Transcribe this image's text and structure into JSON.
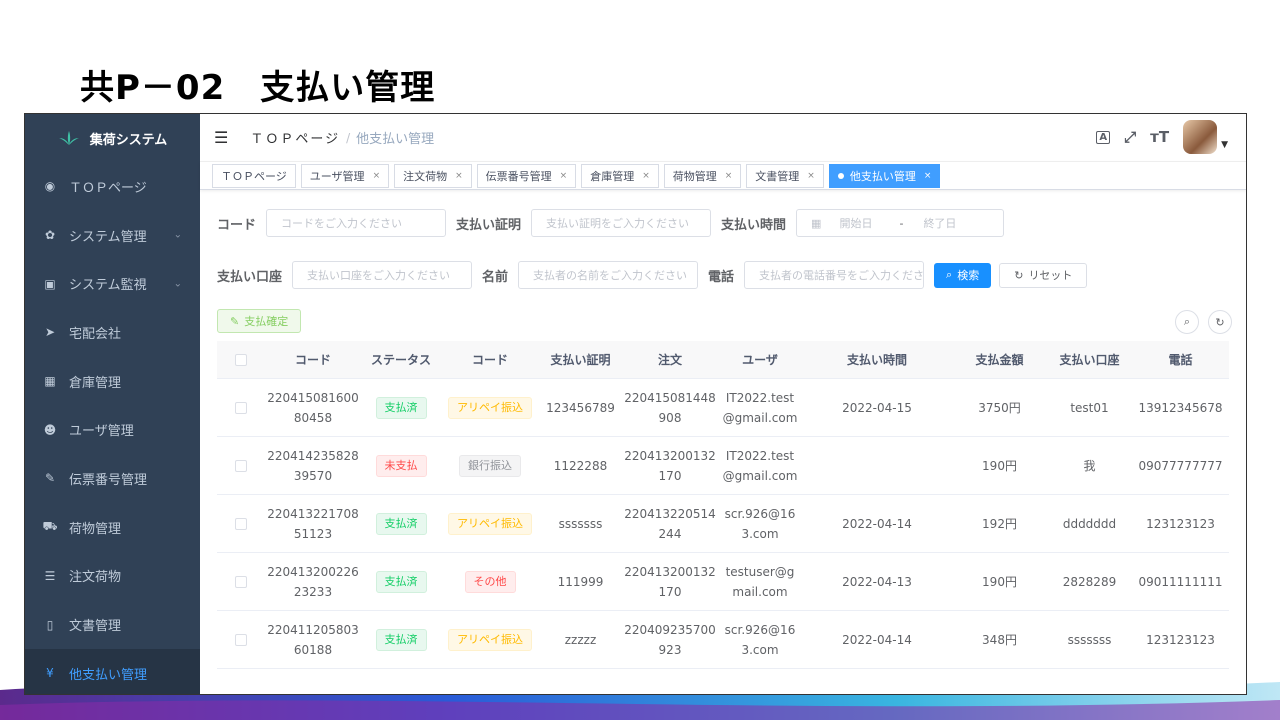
{
  "slide": {
    "title": "共P－02　支払い管理"
  },
  "sidebar": {
    "brand": "集荷システム",
    "items": [
      {
        "label": "ＴＯＰページ",
        "icon": "dashboard-icon",
        "glyph": "◉",
        "chevron": false
      },
      {
        "label": "システム管理",
        "icon": "gear-icon",
        "glyph": "✿",
        "chevron": true
      },
      {
        "label": "システム監視",
        "icon": "monitor-icon",
        "glyph": "▣",
        "chevron": true
      },
      {
        "label": "宅配会社",
        "icon": "send-icon",
        "glyph": "➤",
        "chevron": false
      },
      {
        "label": "倉庫管理",
        "icon": "grid-icon",
        "glyph": "▦",
        "chevron": false
      },
      {
        "label": "ユーザ管理",
        "icon": "users-icon",
        "glyph": "☻",
        "chevron": false
      },
      {
        "label": "伝票番号管理",
        "icon": "edit-icon",
        "glyph": "✎",
        "chevron": false
      },
      {
        "label": "荷物管理",
        "icon": "cart-icon",
        "glyph": "⛟",
        "chevron": false
      },
      {
        "label": "注文荷物",
        "icon": "list-icon",
        "glyph": "☰",
        "chevron": false
      },
      {
        "label": "文書管理",
        "icon": "book-icon",
        "glyph": "▯",
        "chevron": false
      },
      {
        "label": "他支払い管理",
        "icon": "yen-icon",
        "glyph": "¥",
        "chevron": false,
        "active": true
      }
    ]
  },
  "navbar": {
    "breadcrumb_top": "ＴＯＰページ",
    "breadcrumb_sep": "/",
    "breadcrumb_current": "他支払い管理"
  },
  "tags": [
    {
      "label": "ＴＯＰページ",
      "closable": false
    },
    {
      "label": "ユーザ管理",
      "closable": true
    },
    {
      "label": "注文荷物",
      "closable": true
    },
    {
      "label": "伝票番号管理",
      "closable": true
    },
    {
      "label": "倉庫管理",
      "closable": true
    },
    {
      "label": "荷物管理",
      "closable": true
    },
    {
      "label": "文書管理",
      "closable": true
    },
    {
      "label": "他支払い管理",
      "closable": true,
      "active": true
    }
  ],
  "filters": {
    "code_label": "コード",
    "code_placeholder": "コードをご入力ください",
    "proof_label": "支払い証明",
    "proof_placeholder": "支払い証明をご入力ください",
    "time_label": "支払い時間",
    "start_placeholder": "開始日",
    "range_sep": "-",
    "end_placeholder": "終了日",
    "account_label": "支払い口座",
    "account_placeholder": "支払い口座をご入力ください",
    "name_label": "名前",
    "name_placeholder": "支払者の名前をご入力ください",
    "phone_label": "電話",
    "phone_placeholder": "支払者の電話番号をご入力ください",
    "search_label": "検索",
    "reset_label": "リセット"
  },
  "toolbar": {
    "confirm_label": "支払確定"
  },
  "table": {
    "headers": [
      "コード",
      "ステータス",
      "コード",
      "支払い証明",
      "注文",
      "ユーザ",
      "支払い時間",
      "支払金額",
      "支払い口座",
      "電話"
    ],
    "rows": [
      {
        "code": "22041508160080458",
        "status": "支払済",
        "status_color": "green",
        "method": "アリペイ振込",
        "method_color": "yellow",
        "proof": "123456789",
        "order": "220415081448908",
        "user": "IT2022.test@gmail.com",
        "time": "2022-04-15",
        "amount": "3750円",
        "account": "test01",
        "phone": "13912345678"
      },
      {
        "code": "22041423582839570",
        "status": "未支払",
        "status_color": "red",
        "method": "銀行振込",
        "method_color": "gray",
        "proof": "1122288",
        "order": "220413200132170",
        "user": "IT2022.test@gmail.com",
        "time": "",
        "amount": "190円",
        "account": "我",
        "phone": "09077777777"
      },
      {
        "code": "22041322170851123",
        "status": "支払済",
        "status_color": "green",
        "method": "アリペイ振込",
        "method_color": "yellow",
        "proof": "sssssss",
        "order": "220413220514244",
        "user": "scr.926@163.com",
        "time": "2022-04-14",
        "amount": "192円",
        "account": "ddddddd",
        "phone": "123123123"
      },
      {
        "code": "22041320022623233",
        "status": "支払済",
        "status_color": "green",
        "method": "その他",
        "method_color": "red",
        "proof": "111999",
        "order": "220413200132170",
        "user": "testuser@gmail.com",
        "time": "2022-04-13",
        "amount": "190円",
        "account": "2828289",
        "phone": "09011111111"
      },
      {
        "code": "22041120580360188",
        "status": "支払済",
        "status_color": "green",
        "method": "アリペイ振込",
        "method_color": "yellow",
        "proof": "zzzzz",
        "order": "220409235700923",
        "user": "scr.926@163.com",
        "time": "2022-04-14",
        "amount": "348円",
        "account": "sssssss",
        "phone": "123123123"
      }
    ]
  },
  "colors": {
    "sidebar_bg": "#304156",
    "primary": "#409eff",
    "active_tag": "#409eff"
  }
}
